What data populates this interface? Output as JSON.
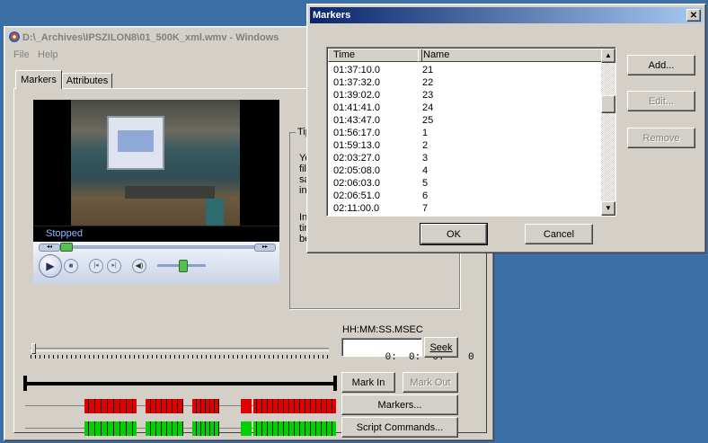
{
  "main_window": {
    "title": "D:\\_Archives\\IPSZILON8\\01_500K_xml.wmv - Windows",
    "menu": [
      "File",
      "Help"
    ],
    "tabs": [
      "Markers",
      "Attributes"
    ],
    "player_status": "Stopped",
    "tip_label": "Tip",
    "tip_lines_1": [
      "Yo",
      "file",
      "sa",
      "ind"
    ],
    "tip_lines_2": [
      "In",
      "tim",
      "be"
    ],
    "time_format_label": "HH:MM:SS.MSEC",
    "time_value": "0:  0:  0.    0",
    "seek_label": "Seek",
    "mark_in_label": "Mark In",
    "mark_out_label": "Mark Out",
    "markers_button_label": "Markers...",
    "script_commands_label": "Script Commands..."
  },
  "markers_dialog": {
    "title": "Markers",
    "close_glyph": "✕",
    "columns": [
      "Time",
      "Name"
    ],
    "rows": [
      {
        "time": "01:37:10.0",
        "name": "21"
      },
      {
        "time": "01:37:32.0",
        "name": "22"
      },
      {
        "time": "01:39:02.0",
        "name": "23"
      },
      {
        "time": "01:41:41.0",
        "name": "24"
      },
      {
        "time": "01:43:47.0",
        "name": "25"
      },
      {
        "time": "01:56:17.0",
        "name": "1"
      },
      {
        "time": "01:59:13.0",
        "name": "2"
      },
      {
        "time": "02:03:27.0",
        "name": "3"
      },
      {
        "time": "02:05:08.0",
        "name": "4"
      },
      {
        "time": "02:06:03.0",
        "name": "5"
      },
      {
        "time": "02:06:51.0",
        "name": "6"
      },
      {
        "time": "02:11:00.0",
        "name": "7"
      }
    ],
    "add_label": "Add...",
    "edit_label": "Edit...",
    "remove_label": "Remove",
    "ok_label": "OK",
    "cancel_label": "Cancel"
  },
  "colors": {
    "desktop": "#3a6ea5",
    "title_active_start": "#0a246a",
    "title_active_end": "#a6caf0",
    "marker_red": "#e00000",
    "marker_green": "#00d000"
  }
}
